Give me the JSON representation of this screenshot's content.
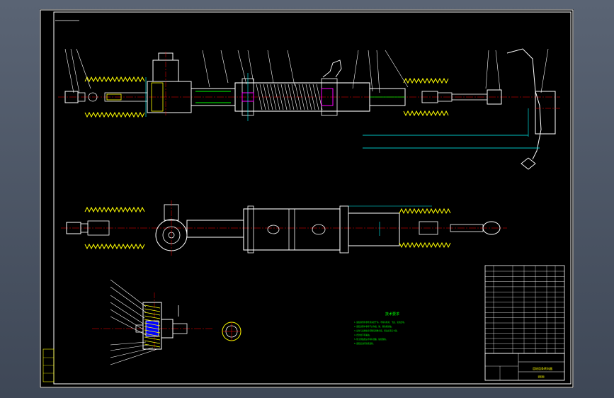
{
  "viewport": {
    "background": "#4a5363",
    "sheet_background": "#000000"
  },
  "colors": {
    "outline": "#ffffff",
    "boot": "#ffff00",
    "section": "#ff00ff",
    "dimension": "#00ffff",
    "centerline": "#ff0000",
    "leader": "#ffffff",
    "notes": "#00ff00"
  },
  "drawing": {
    "views": [
      {
        "name": "front-section-view"
      },
      {
        "name": "top-view"
      },
      {
        "name": "pinion-detail-view"
      },
      {
        "name": "section-circle-view"
      }
    ],
    "technical_requirements": {
      "title": "技术要求",
      "lines": [
        "1. 装配前所有零件须清洗干净，不得有毛刺、飞边、氧化皮等。",
        "2. 装配过程中零件不允许磕、碰、划伤和锈蚀。",
        "3. 齿条与齿轮啮合间隙应调整合适，转动灵活无卡滞。",
        "4. 密封处不得漏油。",
        "5. 防尘罩装配后不得有扭曲、破损现象。",
        "6. 装配后进行性能试验。"
      ]
    },
    "title_block": {
      "name": "齿轮齿条转向器",
      "subtitle": "装配图"
    }
  }
}
